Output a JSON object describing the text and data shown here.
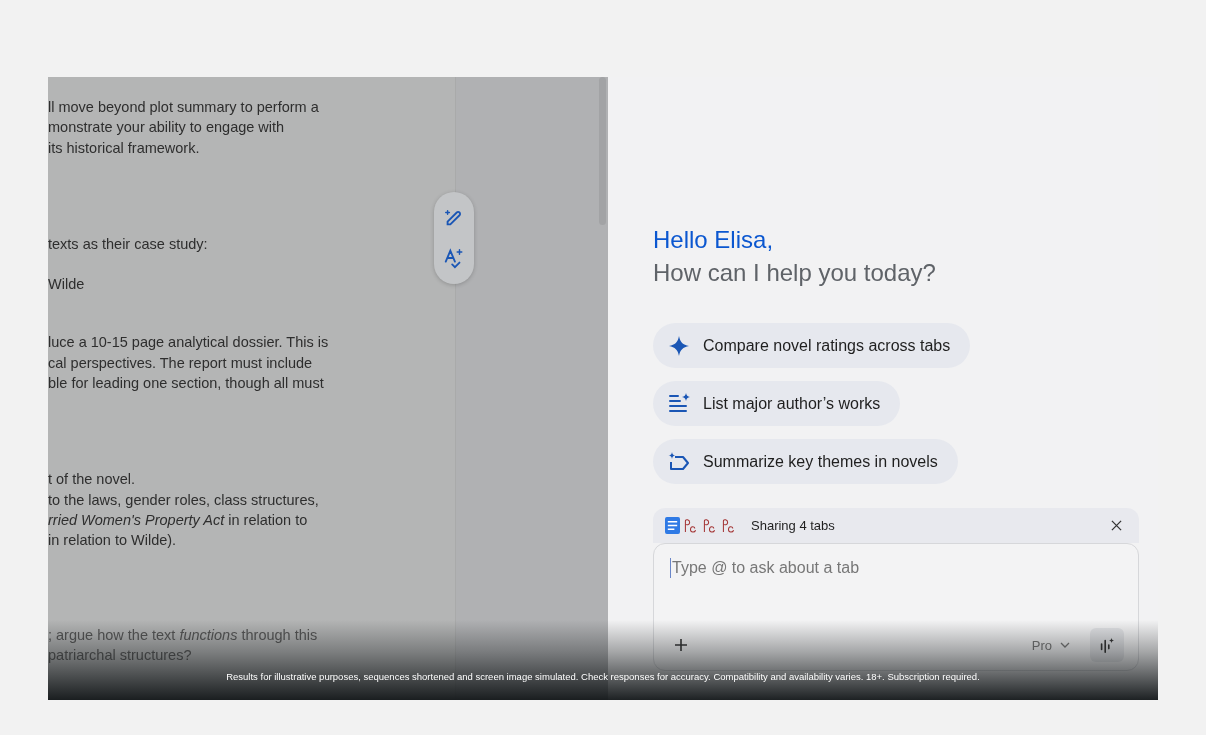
{
  "document": {
    "paragraphs": [
      [
        "ll move beyond plot summary to perform a",
        "monstrate your ability to engage with",
        " its historical framework."
      ],
      [
        "texts as their case study:"
      ],
      [
        "Wilde"
      ],
      [
        "luce a 10-15 page analytical dossier. This is",
        "cal perspectives. The report must include",
        "ble for leading one section, though all must"
      ],
      [
        "t of the novel.",
        "to the laws, gender roles, class structures,",
        "*rried Women's Property Act* in relation to",
        " in relation to Wilde)."
      ],
      [
        "; argue how the text *functions* through this",
        " patriarchal structures?"
      ]
    ]
  },
  "assistant": {
    "greeting": "Hello Elisa,",
    "prompt": "How can I help you today?",
    "suggestions": [
      {
        "kind": "sparkle",
        "label": "Compare novel ratings across tabs"
      },
      {
        "kind": "list",
        "label": "List major author’s works"
      },
      {
        "kind": "tag",
        "label": "Summarize key themes in novels"
      }
    ],
    "composer": {
      "sharing_label": "Sharing 4 tabs",
      "placeholder": "Type @ to ask about a tab",
      "model": "Pro"
    }
  },
  "disclaimer": "Results for illustrative purposes, sequences shortened and screen image simulated. Check responses for accuracy. Compatibility and availability varies. 18+. Subscription required."
}
